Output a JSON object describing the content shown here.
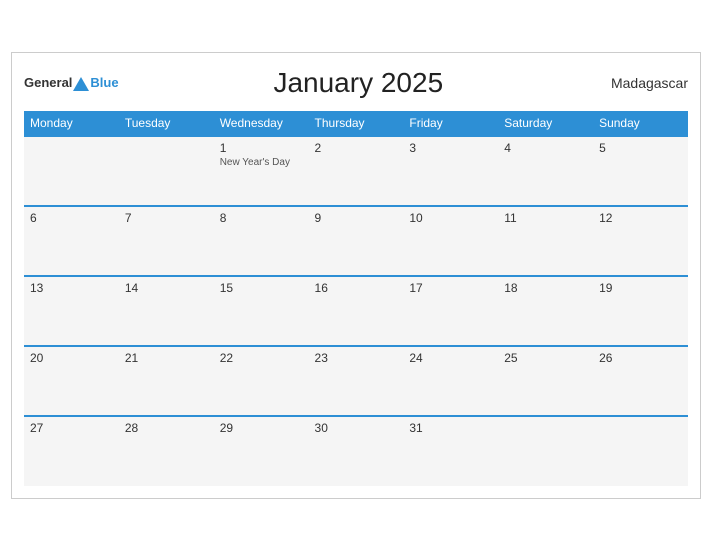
{
  "header": {
    "logo_general": "General",
    "logo_blue": "Blue",
    "title": "January 2025",
    "country": "Madagascar"
  },
  "weekdays": [
    "Monday",
    "Tuesday",
    "Wednesday",
    "Thursday",
    "Friday",
    "Saturday",
    "Sunday"
  ],
  "weeks": [
    [
      {
        "day": "",
        "empty": true
      },
      {
        "day": "",
        "empty": true
      },
      {
        "day": "1",
        "event": "New Year's Day"
      },
      {
        "day": "2"
      },
      {
        "day": "3"
      },
      {
        "day": "4"
      },
      {
        "day": "5"
      }
    ],
    [
      {
        "day": "6"
      },
      {
        "day": "7"
      },
      {
        "day": "8"
      },
      {
        "day": "9"
      },
      {
        "day": "10"
      },
      {
        "day": "11"
      },
      {
        "day": "12"
      }
    ],
    [
      {
        "day": "13"
      },
      {
        "day": "14"
      },
      {
        "day": "15"
      },
      {
        "day": "16"
      },
      {
        "day": "17"
      },
      {
        "day": "18"
      },
      {
        "day": "19"
      }
    ],
    [
      {
        "day": "20"
      },
      {
        "day": "21"
      },
      {
        "day": "22"
      },
      {
        "day": "23"
      },
      {
        "day": "24"
      },
      {
        "day": "25"
      },
      {
        "day": "26"
      }
    ],
    [
      {
        "day": "27"
      },
      {
        "day": "28"
      },
      {
        "day": "29"
      },
      {
        "day": "30"
      },
      {
        "day": "31"
      },
      {
        "day": "",
        "empty": true
      },
      {
        "day": "",
        "empty": true
      }
    ]
  ]
}
